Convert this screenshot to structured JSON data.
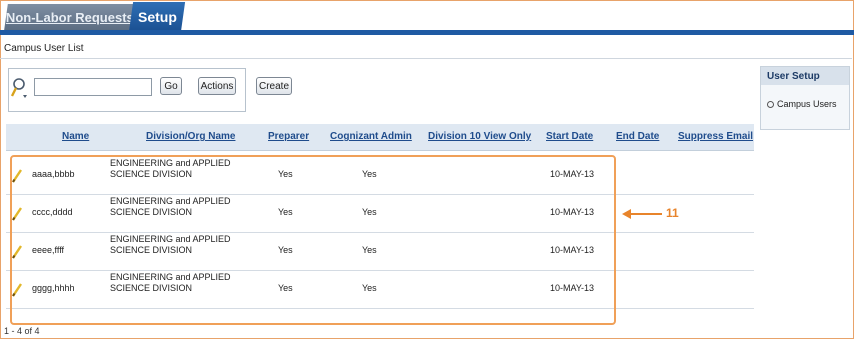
{
  "tabs": [
    {
      "label": "Non-Labor Requests"
    },
    {
      "label": "Setup"
    }
  ],
  "page_title": "Campus User List",
  "toolbar": {
    "search_value": "",
    "go_label": "Go",
    "actions_label": "Actions",
    "create_label": "Create"
  },
  "table": {
    "headers": [
      "Name",
      "Division/Org Name",
      "Preparer",
      "Cognizant Admin",
      "Division 10 View Only",
      "Start Date",
      "End Date",
      "Suppress Email"
    ],
    "rows": [
      {
        "name": "aaaa,bbbb",
        "division": "ENGINEERING and APPLIED SCIENCE DIVISION",
        "preparer": "Yes",
        "cognizant_admin": "Yes",
        "start_date": "10-MAY-13"
      },
      {
        "name": "cccc,dddd",
        "division": "ENGINEERING and APPLIED SCIENCE DIVISION",
        "preparer": "Yes",
        "cognizant_admin": "Yes",
        "start_date": "10-MAY-13"
      },
      {
        "name": "eeee,ffff",
        "division": "ENGINEERING and APPLIED SCIENCE DIVISION",
        "preparer": "Yes",
        "cognizant_admin": "Yes",
        "start_date": "10-MAY-13"
      },
      {
        "name": "gggg,hhhh",
        "division": "ENGINEERING and APPLIED SCIENCE DIVISION",
        "preparer": "Yes",
        "cognizant_admin": "Yes",
        "start_date": "10-MAY-13"
      }
    ]
  },
  "pager": "1 - 4 of 4",
  "callout": {
    "number": "11",
    "color": "#e8842b"
  },
  "side_panel": {
    "title": "User Setup",
    "items": [
      {
        "label": "Campus Users"
      }
    ]
  },
  "icons": {
    "search": "search-icon",
    "edit": "pencil-icon",
    "bullet": "bullet-icon"
  }
}
